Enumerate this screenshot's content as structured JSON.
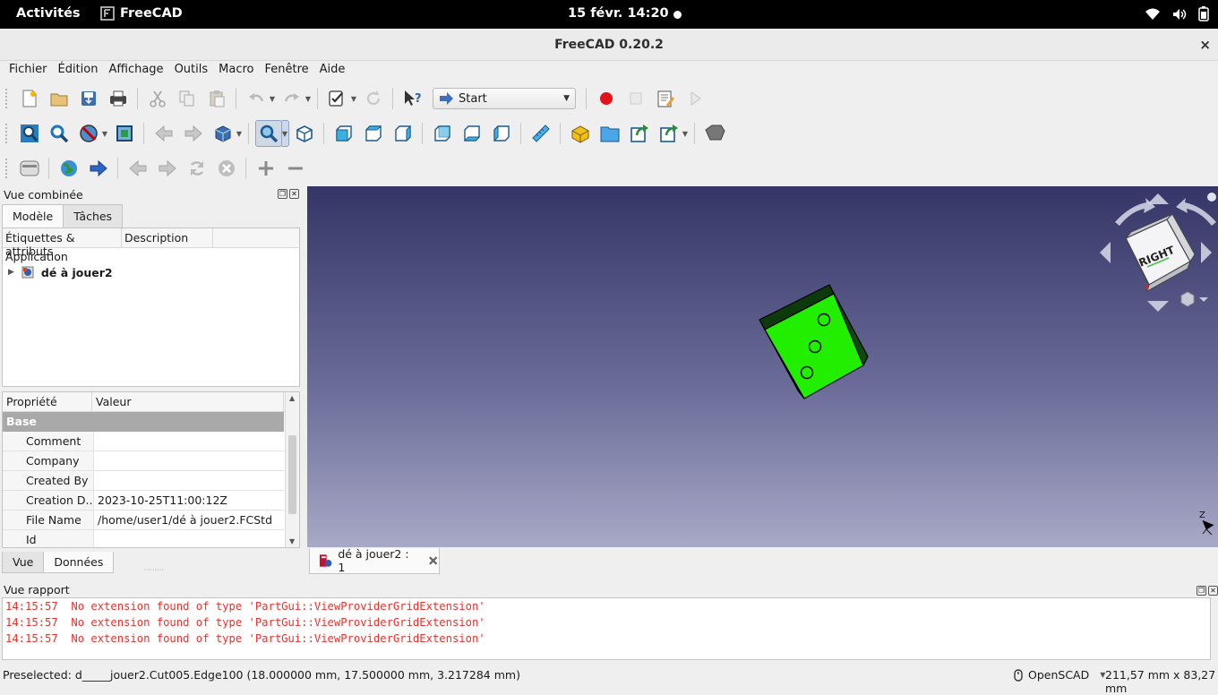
{
  "system_bar": {
    "activities": "Activités",
    "app_name": "FreeCAD",
    "clock": "15 févr.  14:20"
  },
  "window": {
    "title": "FreeCAD 0.20.2",
    "close": "×"
  },
  "menubar": [
    "Fichier",
    "Édition",
    "Affichage",
    "Outils",
    "Macro",
    "Fenêtre",
    "Aide"
  ],
  "toolbar": {
    "workbench_selector": "Start"
  },
  "combo_view": {
    "title": "Vue combinée",
    "tabs": [
      "Modèle",
      "Tâches"
    ],
    "tree_columns": [
      "Étiquettes & attributs",
      "Description"
    ],
    "tree_root": "Application",
    "tree_document": "dé à jouer2",
    "property_columns": [
      "Propriété",
      "Valeur"
    ],
    "property_group": "Base",
    "properties": [
      {
        "name": "Comment",
        "value": ""
      },
      {
        "name": "Company",
        "value": ""
      },
      {
        "name": "Created By",
        "value": ""
      },
      {
        "name": "Creation D...",
        "value": "2023-10-25T11:00:12Z"
      },
      {
        "name": "File Name",
        "value": "/home/user1/dé à jouer2.FCStd"
      },
      {
        "name": "Id",
        "value": ""
      }
    ],
    "bottom_tabs": [
      "Vue",
      "Données"
    ]
  },
  "viewport": {
    "navcube_face": "RIGHT",
    "axis_label": "Z",
    "doc_tab": "dé à jouer2 : 1",
    "background_top": "#353567",
    "background_bottom": "#a8a9c6",
    "object_color": "#22ee00"
  },
  "report": {
    "title": "Vue rapport",
    "lines": [
      "14:15:57  No extension found of type 'PartGui::ViewProviderGridExtension'",
      "14:15:57  No extension found of type 'PartGui::ViewProviderGridExtension'",
      "14:15:57  No extension found of type 'PartGui::ViewProviderGridExtension'"
    ]
  },
  "statusbar": {
    "message": "Preselected: d_____jouer2.Cut005.Edge100 (18.000000 mm, 17.500000 mm, 3.217284 mm)",
    "navigation_style": "OpenSCAD",
    "dimensions": "211,57 mm x 83,27 mm"
  }
}
